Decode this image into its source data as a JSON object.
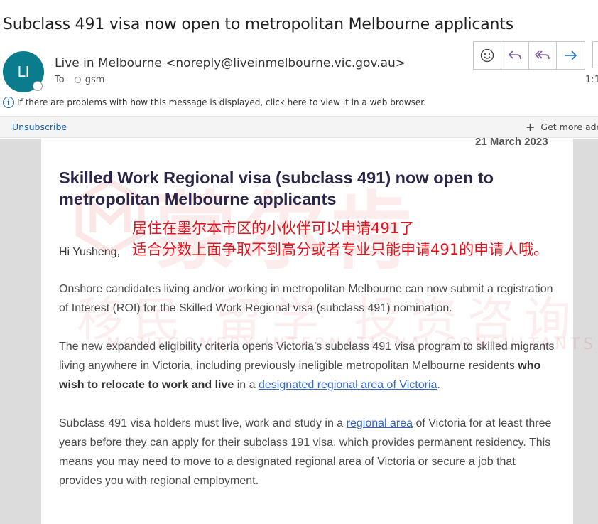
{
  "email": {
    "subject": "Subclass 491 visa now open to metropolitan Melbourne applicants",
    "avatar_initials": "LI",
    "sender": "Live in Melbourne <noreply@liveinmelbourne.vic.gov.au>",
    "to_label": "To",
    "to_recipient": "gsm",
    "time": "1:1",
    "info_text": "If there are problems with how this message is displayed, click here to view it in a web browser.",
    "unsubscribe": "Unsubscribe",
    "get_more": "Get more add",
    "actions": [
      {
        "name": "emoji-button",
        "icon": "smiley-icon"
      },
      {
        "name": "reply-button",
        "icon": "reply-icon"
      },
      {
        "name": "reply-all-button",
        "icon": "reply-all-icon"
      },
      {
        "name": "forward-button",
        "icon": "forward-icon"
      }
    ]
  },
  "content": {
    "date": "21 March 2023",
    "headline": "Skilled Work Regional visa (subclass 491) now open to metropolitan Melbourne applicants",
    "greeting": "Hi Yusheng,",
    "para1": "Onshore candidates living and/or working in metropolitan Melbourne can now submit a registration of Interest (ROI) for the Skilled Work Regional visa (subclass 491) nomination.",
    "para2_a": "The new expanded eligibility criteria opens Victoria’s subclass 491 visa program to skilled migrants living anywhere in Victoria, including previously ineligible metropolitan Melbourne residents ",
    "para2_bold": "who wish to relocate to work and live",
    "para2_b": " in a ",
    "para2_link": "designated regional area of Victoria",
    "para2_c": ".",
    "para3_a": "Subclass 491 visa holders must live, work and study in a ",
    "para3_link": "regional area",
    "para3_b": " of Victoria for at least three years before they can apply for their subclass 191 visa, which provides permanent residency.  This means you may need to move to a designated regional area of Victoria or secure a job that provides you with regional employment."
  },
  "annotation": {
    "line1": "居住在墨尔本市区的小伙伴可以申请491了",
    "line2": "适合分数上面争取不到高分或者专业只能申请491的申请人哦。"
  },
  "watermark": {
    "big": "蒙尔肯",
    "sub": "移民 留学 投资咨询",
    "en": "MONTGOMERY INTERNATIONAL CONSULTANTS"
  },
  "colors": {
    "avatar": "#0b7c8d",
    "link": "#3366cc",
    "headline": "#2b2547",
    "annotation": "#e3121b",
    "action_icon": "#7a5aa6",
    "forward_icon": "#1a73c8"
  }
}
